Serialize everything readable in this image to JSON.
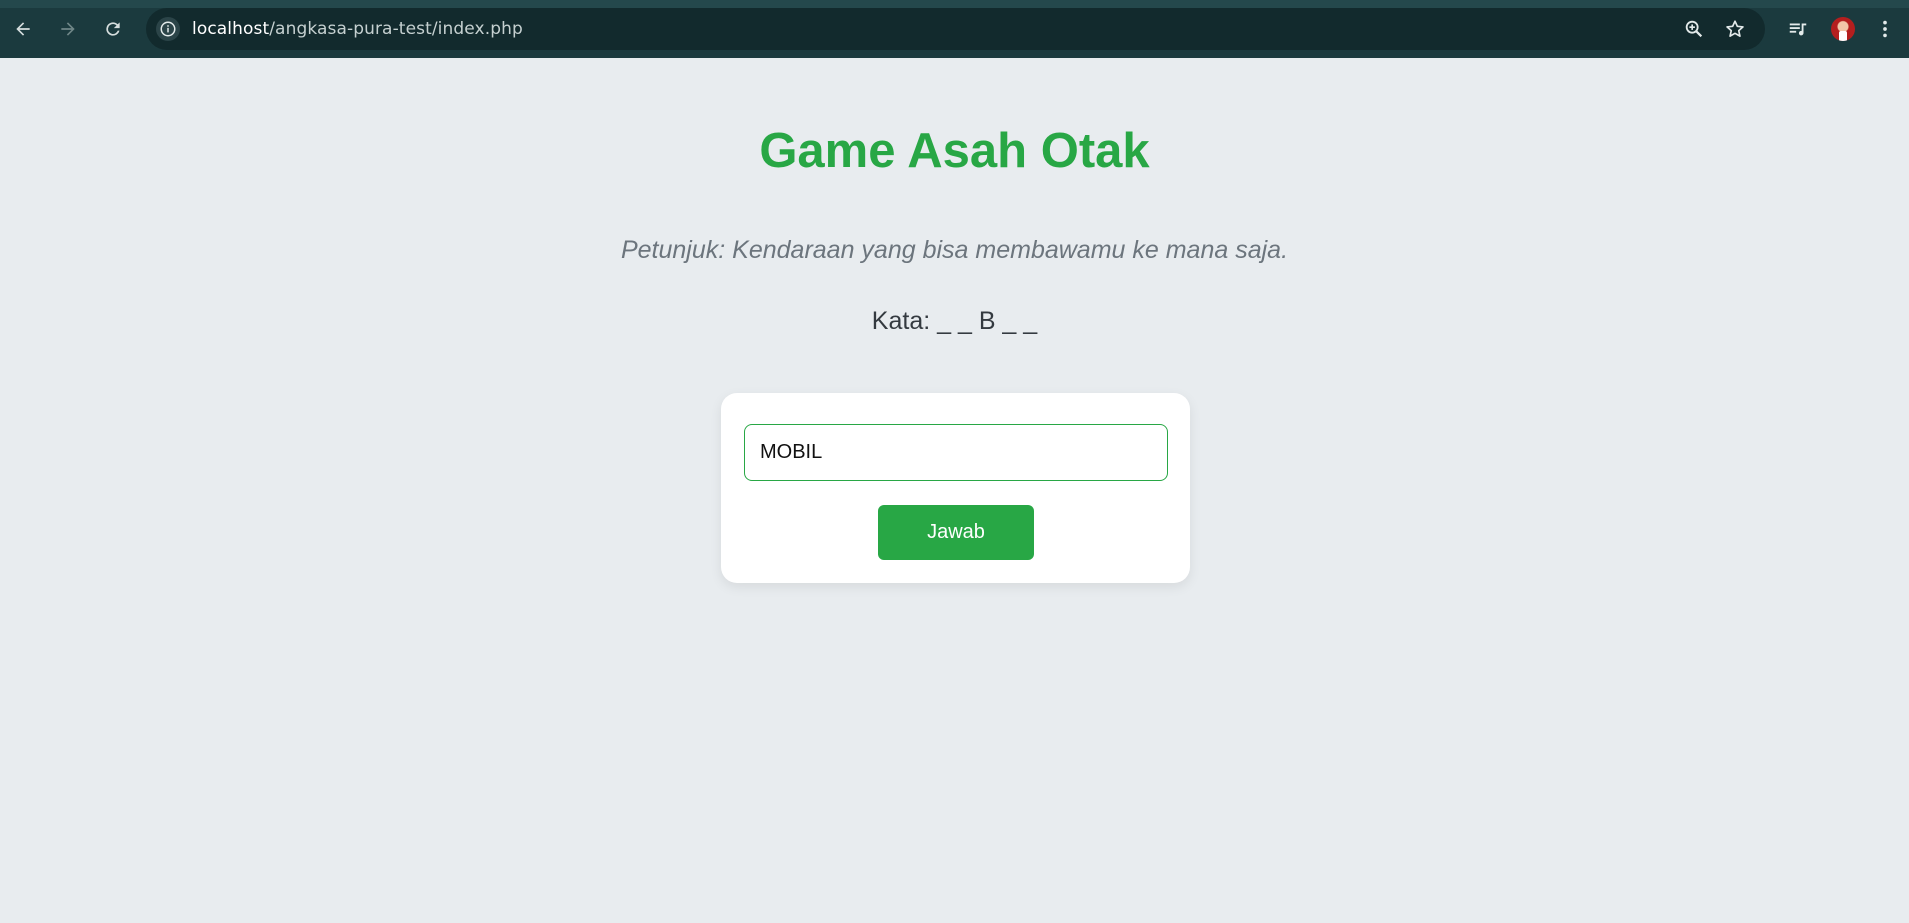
{
  "browser": {
    "url_host": "localhost",
    "url_path": "/angkasa-pura-test/index.php",
    "icons": [
      "back-arrow-icon",
      "forward-arrow-icon",
      "reload-icon",
      "info-icon",
      "zoom-icon",
      "star-icon",
      "media-queue-icon",
      "profile-avatar-icon",
      "more-vert-icon"
    ]
  },
  "game": {
    "title": "Game Asah Otak",
    "hint": "Petunjuk: Kendaraan yang bisa membawamu ke mana saja.",
    "word": "Kata: _ _ B _ _",
    "answer_value": "MOBIL",
    "submit_label": "Jawab"
  },
  "colors": {
    "accent": "#28a745",
    "page_background": "#e8ecef",
    "hint_text": "#6c757d",
    "browser_chrome": "#1b3a3e"
  }
}
